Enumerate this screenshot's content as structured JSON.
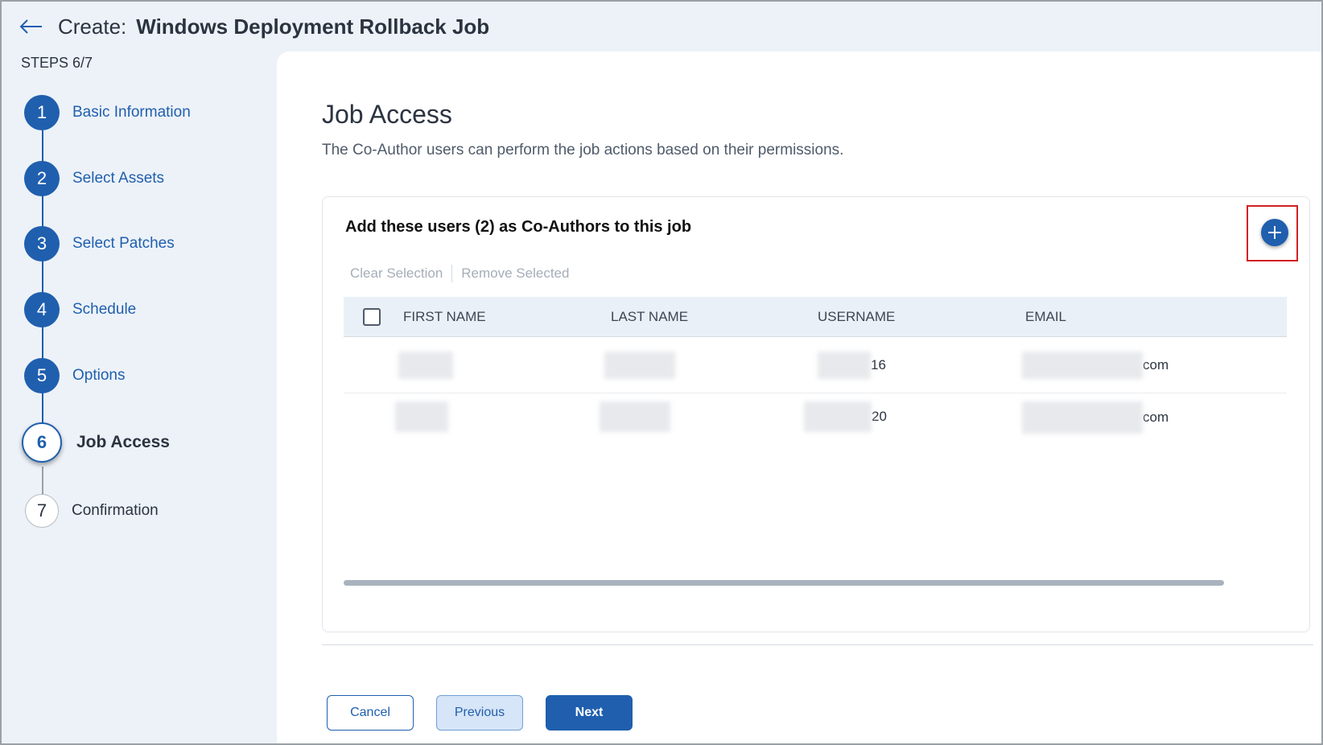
{
  "header": {
    "prefix": "Create:",
    "title": "Windows Deployment Rollback Job"
  },
  "sidebar": {
    "steps_label": "STEPS 6/7",
    "steps": [
      {
        "number": "1",
        "label": "Basic Information",
        "state": "completed"
      },
      {
        "number": "2",
        "label": "Select Assets",
        "state": "completed"
      },
      {
        "number": "3",
        "label": "Select Patches",
        "state": "completed"
      },
      {
        "number": "4",
        "label": "Schedule",
        "state": "completed"
      },
      {
        "number": "5",
        "label": "Options",
        "state": "completed"
      },
      {
        "number": "6",
        "label": "Job Access",
        "state": "current"
      },
      {
        "number": "7",
        "label": "Confirmation",
        "state": "future"
      }
    ]
  },
  "main": {
    "title": "Job Access",
    "description": "The Co-Author users can perform the job actions based on their permissions.",
    "card": {
      "title": "Add these users (2) as Co-Authors to this job",
      "add_icon": "plus-circle-icon",
      "actions": {
        "clear_selection": "Clear Selection",
        "remove_selected": "Remove Selected"
      },
      "table": {
        "columns": [
          "FIRST NAME",
          "LAST NAME",
          "USERNAME",
          "EMAIL"
        ],
        "rows": [
          {
            "first_name": "",
            "last_name": "",
            "username_suffix": "16",
            "email_suffix": "com"
          },
          {
            "first_name": "",
            "last_name": "",
            "username_suffix": "20",
            "email_suffix": "com"
          }
        ]
      }
    }
  },
  "footer": {
    "cancel": "Cancel",
    "previous": "Previous",
    "next": "Next"
  },
  "colors": {
    "primary": "#1f5fae",
    "highlight_border": "#d32020",
    "sidebar_bg": "#edf2f8"
  }
}
